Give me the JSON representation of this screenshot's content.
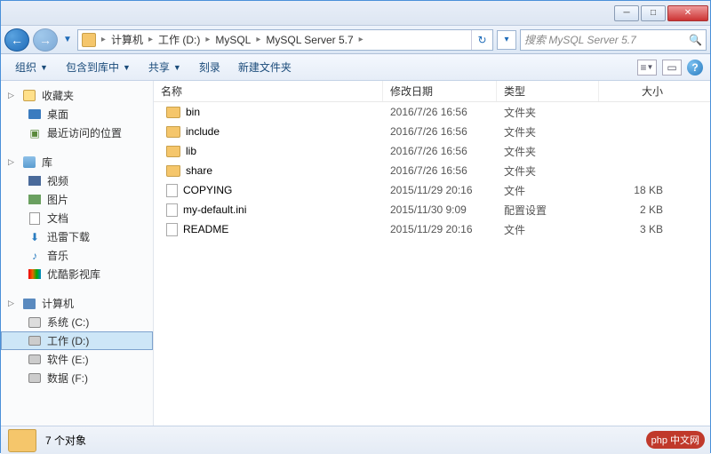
{
  "window_controls": {
    "min": "─",
    "max": "□",
    "close": "✕"
  },
  "nav": {
    "back": "←",
    "forward": "→"
  },
  "breadcrumb": [
    "计算机",
    "工作 (D:)",
    "MySQL",
    "MySQL Server 5.7"
  ],
  "search_placeholder": "搜索 MySQL Server 5.7",
  "toolbar": {
    "organize": "组织",
    "include": "包含到库中",
    "share": "共享",
    "burn": "刻录",
    "newfolder": "新建文件夹"
  },
  "navpane": {
    "favorites": {
      "label": "收藏夹",
      "items": [
        "桌面",
        "最近访问的位置"
      ]
    },
    "libraries": {
      "label": "库",
      "items": [
        "视频",
        "图片",
        "文档",
        "迅雷下载",
        "音乐",
        "优酷影视库"
      ]
    },
    "computer": {
      "label": "计算机",
      "items": [
        "系统 (C:)",
        "工作 (D:)",
        "软件 (E:)",
        "数据 (F:)"
      ],
      "selected": 1
    }
  },
  "columns": {
    "name": "名称",
    "date": "修改日期",
    "type": "类型",
    "size": "大小"
  },
  "files": [
    {
      "name": "bin",
      "date": "2016/7/26 16:56",
      "type": "文件夹",
      "size": "",
      "kind": "folder"
    },
    {
      "name": "include",
      "date": "2016/7/26 16:56",
      "type": "文件夹",
      "size": "",
      "kind": "folder"
    },
    {
      "name": "lib",
      "date": "2016/7/26 16:56",
      "type": "文件夹",
      "size": "",
      "kind": "folder"
    },
    {
      "name": "share",
      "date": "2016/7/26 16:56",
      "type": "文件夹",
      "size": "",
      "kind": "folder"
    },
    {
      "name": "COPYING",
      "date": "2015/11/29 20:16",
      "type": "文件",
      "size": "18 KB",
      "kind": "file"
    },
    {
      "name": "my-default.ini",
      "date": "2015/11/30 9:09",
      "type": "配置设置",
      "size": "2 KB",
      "kind": "file"
    },
    {
      "name": "README",
      "date": "2015/11/29 20:16",
      "type": "文件",
      "size": "3 KB",
      "kind": "file"
    }
  ],
  "status": "7 个对象",
  "watermark": "php 中文网"
}
